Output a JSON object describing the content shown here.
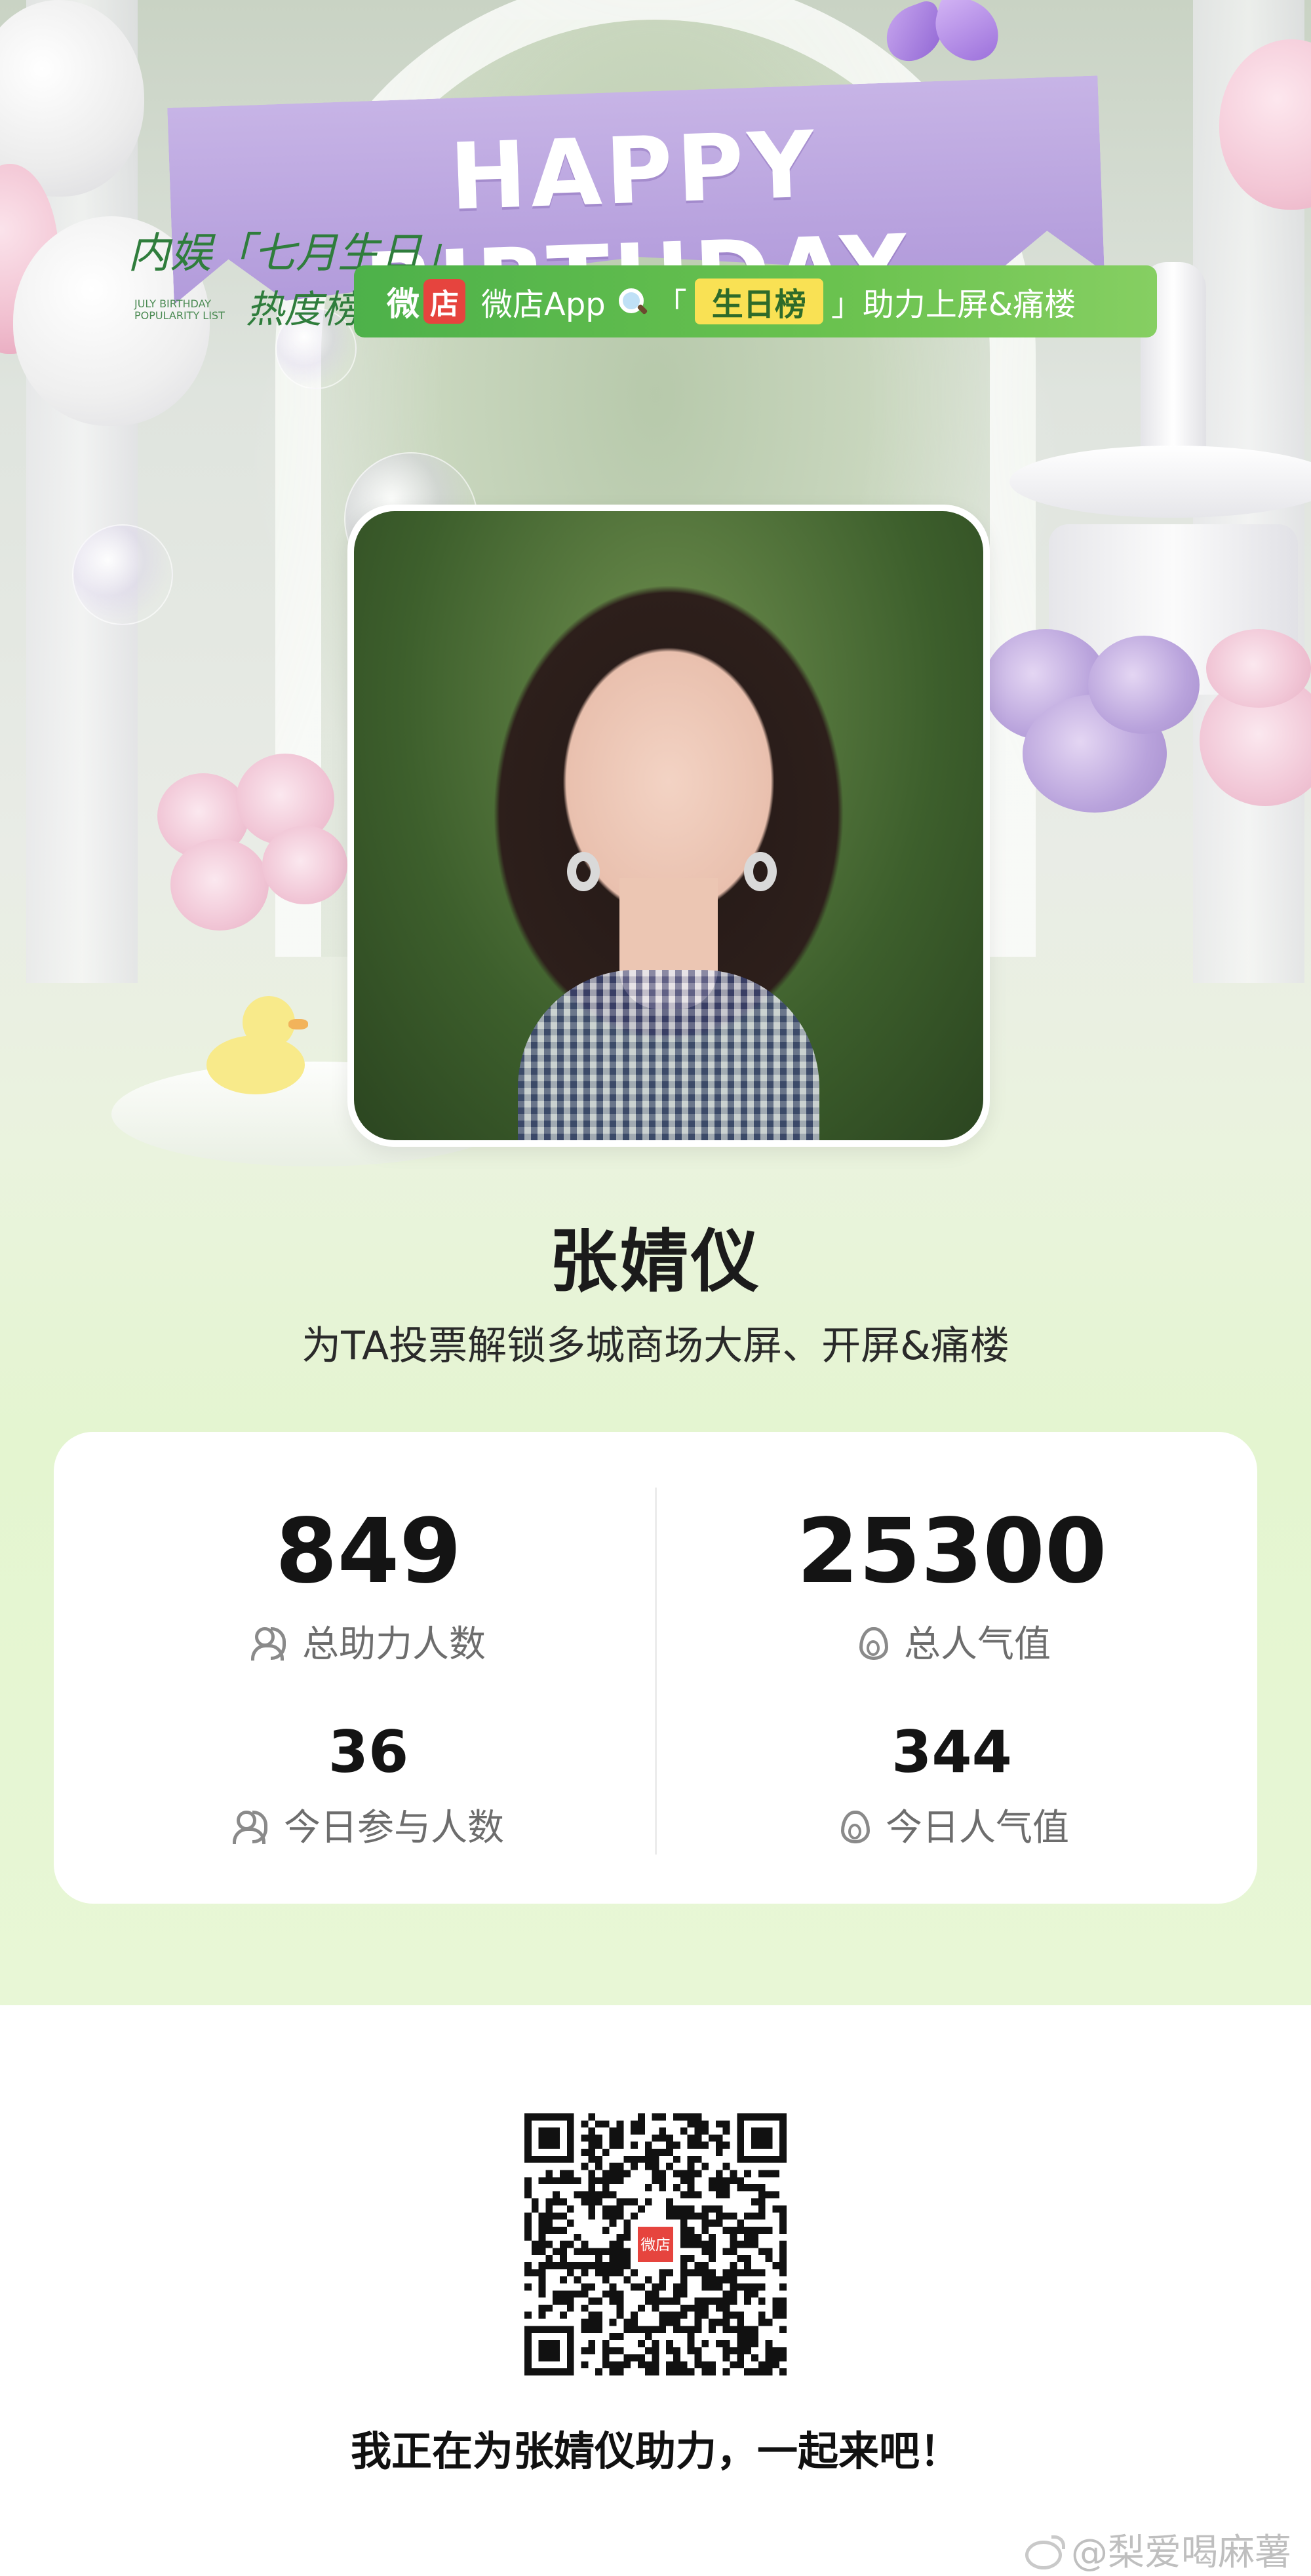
{
  "banner": {
    "text": "HAPPY BIRTHDAY"
  },
  "logo": {
    "line1": "内娱「七月生日」",
    "line2": "热度榜",
    "small": "JULY BIRTHDAY POPULARITY LIST"
  },
  "promo": {
    "brand_prefix": "微",
    "brand_badge": "店",
    "app_name": "微店App",
    "rank_open": "「",
    "rank_label": "生日榜",
    "rank_close": "」",
    "tail": "助力上屏&痛楼",
    "search_icon": "search-icon"
  },
  "profile": {
    "name": "张婧仪",
    "subtitle": "为TA投票解锁多城商场大屏、开屏&痛楼"
  },
  "stats": {
    "total_supporters": {
      "value": "849",
      "label": "总助力人数",
      "icon": "users-icon"
    },
    "total_popularity": {
      "value": "25300",
      "label": "总人气值",
      "icon": "flame-icon"
    },
    "today_supporters": {
      "value": "36",
      "label": "今日参与人数",
      "icon": "users-icon"
    },
    "today_popularity": {
      "value": "344",
      "label": "今日人气值",
      "icon": "flame-icon"
    }
  },
  "qr": {
    "center_badge": "微店"
  },
  "footer": {
    "invite": "我正在为张婧仪助力，一起来吧！",
    "watermark": "@梨爱喝麻薯"
  },
  "colors": {
    "promo_green": "#5cb84b",
    "badge_red": "#e6443e",
    "rank_yellow": "#f9e154",
    "banner_lilac": "#b9a3dc"
  }
}
